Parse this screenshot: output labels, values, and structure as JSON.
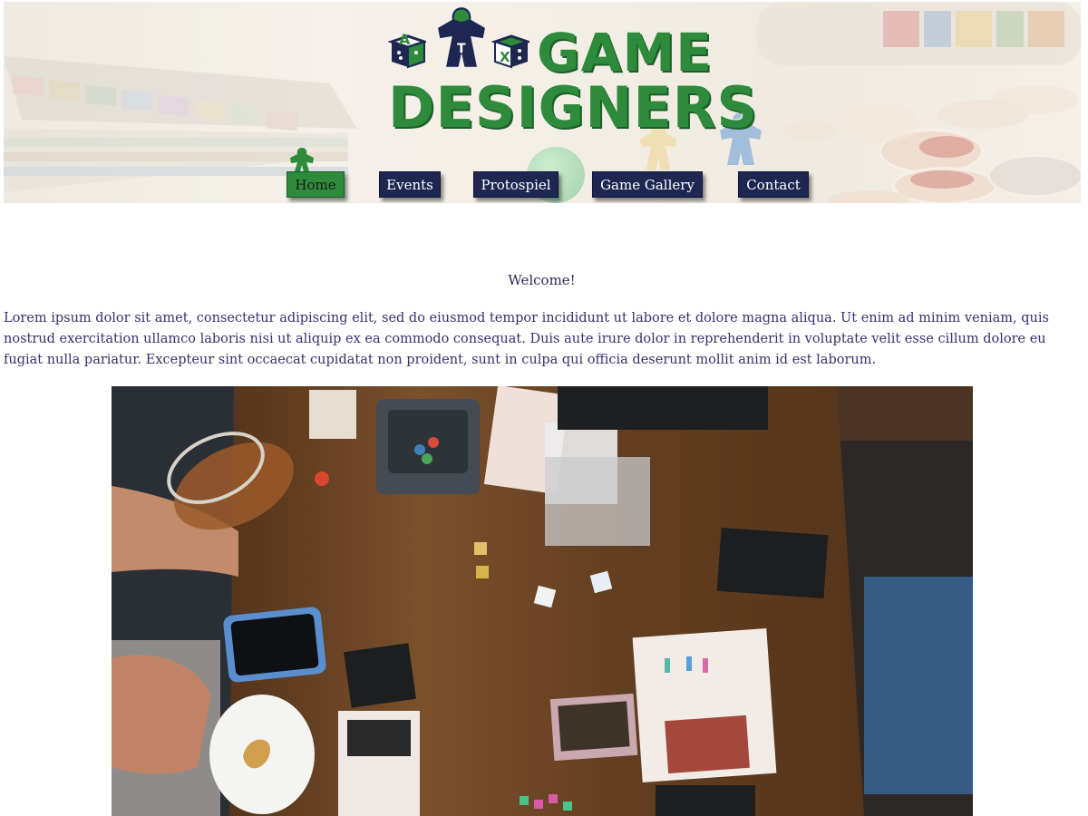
{
  "logo": {
    "line1": "GAME",
    "line2": "DESIGNERS",
    "dice_letters": [
      "A",
      "T",
      "X"
    ]
  },
  "nav": {
    "items": [
      {
        "label": "Home"
      },
      {
        "label": "Events"
      },
      {
        "label": "Protospiel"
      },
      {
        "label": "Game Gallery"
      },
      {
        "label": "Contact"
      }
    ],
    "active": "Home"
  },
  "main": {
    "welcome": "Welcome!",
    "intro": "Lorem ipsum dolor sit amet, consectetur adipiscing elit, sed do eiusmod tempor incididunt ut labore et dolore magna aliqua. Ut enim ad minim veniam, quis nostrud exercitation ullamco laboris nisi ut aliquip ex ea commodo consequat. Duis aute irure dolor in reprehenderit in voluptate velit esse cillum dolore eu fugiat nulla pariatur. Excepteur sint occaecat cupidatat non proident, sunt in culpa qui officia deserunt mollit anim id est laborum."
  },
  "colors": {
    "brand_green": "#2e8b3c",
    "nav_navy": "#1d2752",
    "text_purple": "#3b2f6e"
  }
}
